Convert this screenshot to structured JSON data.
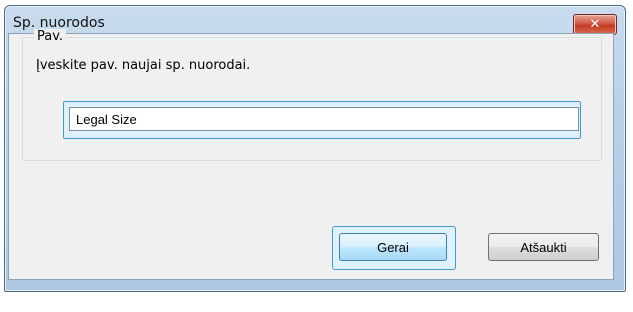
{
  "window": {
    "title": "Sp. nuorodos",
    "close_glyph": "✕"
  },
  "group": {
    "legend": "Pav.",
    "prompt": "Įveskite pav. naujai sp. nuorodai."
  },
  "name_input": {
    "value": "Legal Size"
  },
  "buttons": {
    "ok_label": "Gerai",
    "cancel_label": "Atšaukti"
  },
  "colors": {
    "focus_ring": "#3f9bd4",
    "close_button": "#c23b22",
    "dialog_body": "#f0f0f0"
  }
}
